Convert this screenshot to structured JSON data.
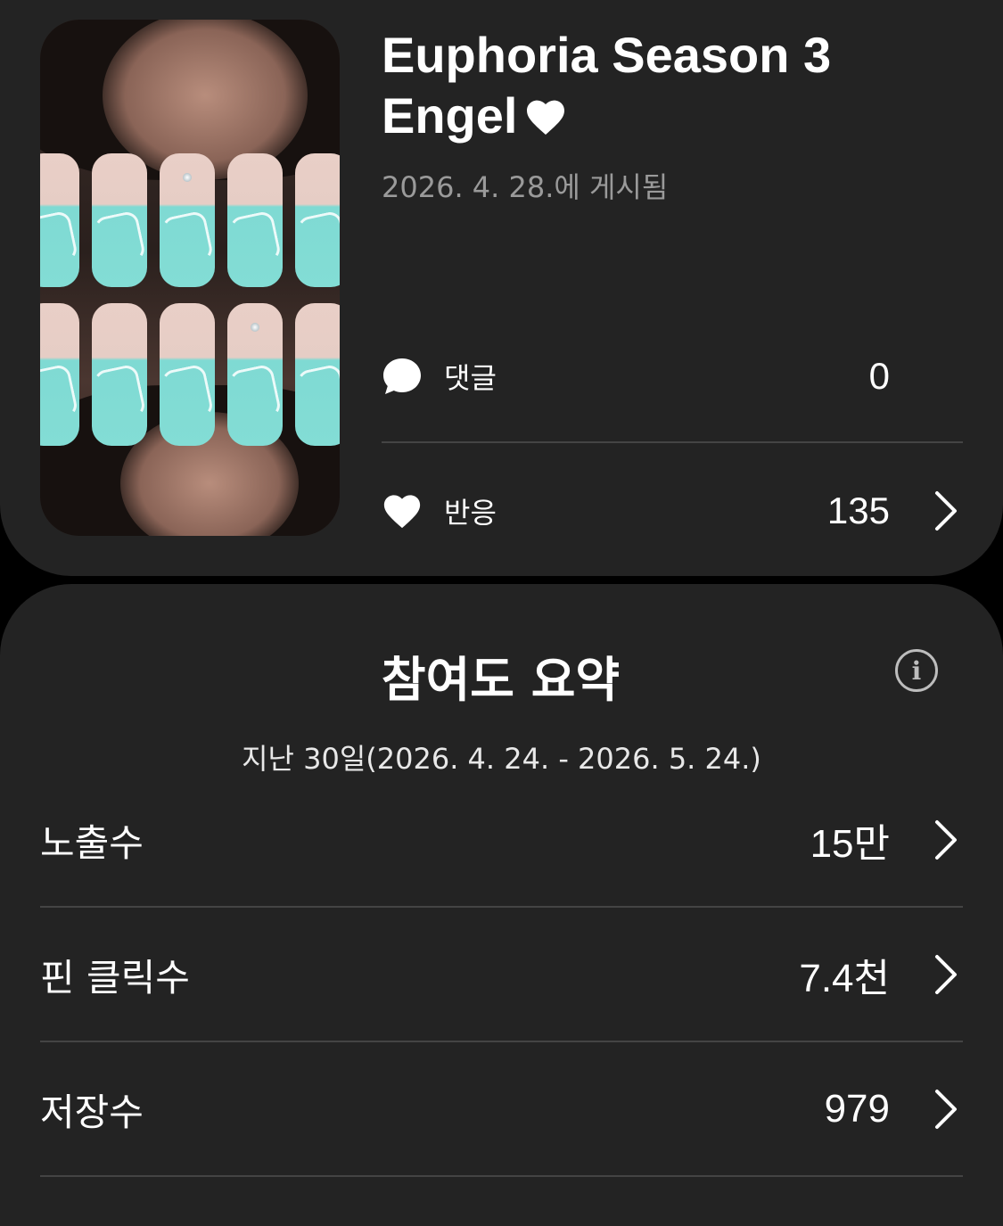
{
  "pin": {
    "title": "Euphoria Season 3 Engel",
    "posted_label": "2026. 4. 28.에 게시됨",
    "thumbnail_alt": "Angel nails image"
  },
  "stats": {
    "comments_label": "댓글",
    "comments_value": "0",
    "reactions_label": "반응",
    "reactions_value": "135"
  },
  "engagement": {
    "title": "참여도 요약",
    "period": "지난 30일(2026. 4. 24. - 2026. 5. 24.)",
    "metrics": [
      {
        "label": "노출수",
        "value": "15만"
      },
      {
        "label": "핀 클릭수",
        "value": "7.4천"
      },
      {
        "label": "저장수",
        "value": "979"
      }
    ]
  },
  "icons": {
    "title_heart": "heart-icon",
    "comment": "comment-bubble-icon",
    "reaction": "heart-icon",
    "chevron": "chevron-right-icon",
    "info": "info-icon"
  },
  "colors": {
    "background": "#000000",
    "card": "#232323",
    "text": "#ffffff",
    "muted": "#9a9a9a",
    "divider": "#444444"
  }
}
